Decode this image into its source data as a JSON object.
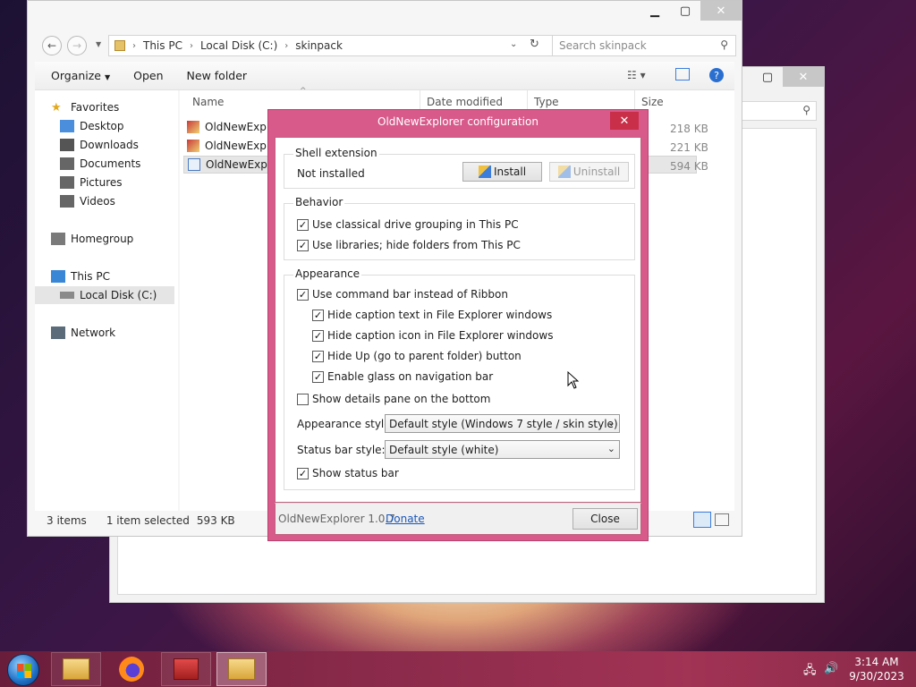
{
  "back_window": {},
  "explorer": {
    "address": {
      "segments": [
        "This PC",
        "Local Disk (C:)",
        "skinpack"
      ]
    },
    "search_placeholder": "Search skinpack",
    "commands": {
      "organize": "Organize",
      "open": "Open",
      "new_folder": "New folder"
    },
    "nav": {
      "favorites": "Favorites",
      "desktop": "Desktop",
      "downloads": "Downloads",
      "documents": "Documents",
      "pictures": "Pictures",
      "videos": "Videos",
      "homegroup": "Homegroup",
      "this_pc": "This PC",
      "local_disk": "Local Disk (C:)",
      "network": "Network"
    },
    "columns": {
      "name": "Name",
      "date_modified": "Date modified",
      "type": "Type",
      "size": "Size"
    },
    "files": [
      {
        "name": "OldNewExpl",
        "size": "218 KB"
      },
      {
        "name": "OldNewExpl",
        "size": "221 KB"
      },
      {
        "name": "OldNewExpl",
        "size": "594 KB"
      }
    ],
    "status": {
      "item_count": "3 items",
      "selection": "1 item selected",
      "selection_size": "593 KB"
    }
  },
  "dialog": {
    "title": "OldNewExplorer configuration",
    "shell_extension": {
      "label": "Shell extension",
      "status": "Not installed",
      "install": "Install",
      "uninstall": "Uninstall"
    },
    "behavior": {
      "label": "Behavior",
      "options": [
        {
          "text": "Use classical drive grouping in This PC",
          "checked": true
        },
        {
          "text": "Use libraries; hide folders from This PC",
          "checked": true
        }
      ]
    },
    "appearance": {
      "label": "Appearance",
      "use_command_bar": {
        "text": "Use command bar instead of Ribbon",
        "checked": true
      },
      "sub_options": [
        {
          "text": "Hide caption text in File Explorer windows",
          "checked": true
        },
        {
          "text": "Hide caption icon in File Explorer windows",
          "checked": true
        },
        {
          "text": "Hide Up (go to parent folder) button",
          "checked": true
        },
        {
          "text": "Enable glass on navigation bar",
          "checked": true
        }
      ],
      "details_pane": {
        "text": "Show details pane on the bottom",
        "checked": false
      },
      "appearance_style_label": "Appearance style:",
      "appearance_style_value": "Default style (Windows 7 style / skin style)",
      "status_bar_style_label": "Status bar style:",
      "status_bar_style_value": "Default style (white)",
      "show_status_bar": {
        "text": "Show status bar",
        "checked": true
      }
    },
    "footer": {
      "version": "OldNewExplorer 1.0.7",
      "donate": "Donate",
      "close": "Close"
    }
  },
  "taskbar": {
    "apps": [
      "file-explorer",
      "firefox",
      "toolbox",
      "oldnewexplorer-config"
    ],
    "clock": {
      "time": "3:14 AM",
      "date": "9/30/2023"
    }
  }
}
